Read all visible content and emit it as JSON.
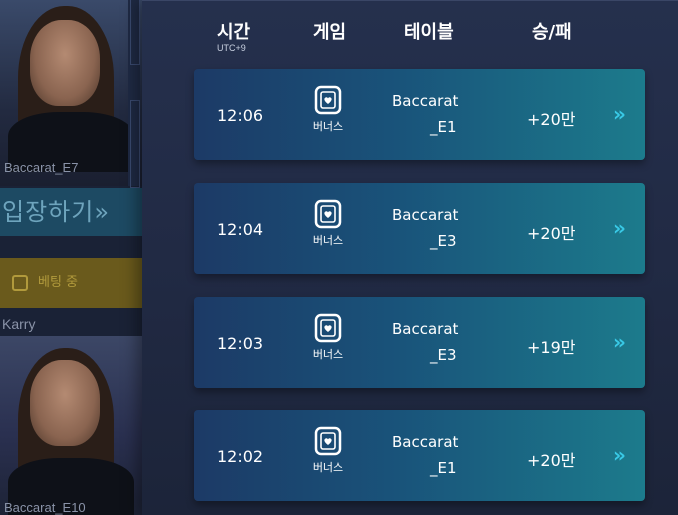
{
  "lobby": {
    "table_top": "Baccarat_E7",
    "enter_label": "입장하기»",
    "betting_label": "베팅 중",
    "host_name": "Karry",
    "table_bottom": "Baccarat_E10"
  },
  "history": {
    "headers": {
      "time": "시간",
      "time_sub": "UTC+9",
      "game": "게임",
      "table": "테이블",
      "result": "승/패"
    },
    "rows": [
      {
        "time": "12:06",
        "game": "버너스",
        "table_line1": "Baccarat",
        "table_line2": "_E1",
        "result": "+20만",
        "arrow": "»"
      },
      {
        "time": "12:04",
        "game": "버너스",
        "table_line1": "Baccarat",
        "table_line2": "_E3",
        "result": "+20만",
        "arrow": "»"
      },
      {
        "time": "12:03",
        "game": "버너스",
        "table_line1": "Baccarat",
        "table_line2": "_E3",
        "result": "+19만",
        "arrow": "»"
      },
      {
        "time": "12:02",
        "game": "버너스",
        "table_line1": "Baccarat",
        "table_line2": "_E1",
        "result": "+20만",
        "arrow": "»"
      }
    ]
  },
  "colors": {
    "panel_bg": "#212a44",
    "row_start": "#1c3a66",
    "row_end": "#1c7b8c",
    "arrow": "#39c9e6"
  },
  "icons": {
    "game": "heart-card-icon",
    "row_action": "double-chevron-right-icon"
  }
}
